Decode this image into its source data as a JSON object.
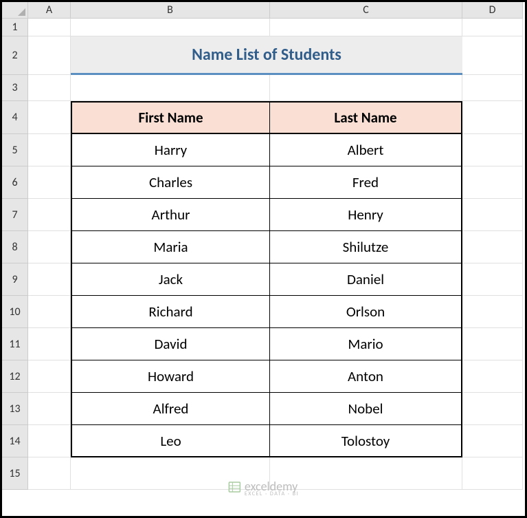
{
  "columns": [
    "A",
    "B",
    "C",
    "D"
  ],
  "rows": [
    "1",
    "2",
    "3",
    "4",
    "5",
    "6",
    "7",
    "8",
    "9",
    "10",
    "11",
    "12",
    "13",
    "14",
    "15"
  ],
  "title": "Name List of Students",
  "headers": {
    "first": "First Name",
    "last": "Last Name"
  },
  "data": [
    {
      "first": "Harry",
      "last": "Albert"
    },
    {
      "first": "Charles",
      "last": "Fred"
    },
    {
      "first": "Arthur",
      "last": "Henry"
    },
    {
      "first": "Maria",
      "last": "Shilutze"
    },
    {
      "first": "Jack",
      "last": "Daniel"
    },
    {
      "first": "Richard",
      "last": "Orlson"
    },
    {
      "first": "David",
      "last": "Mario"
    },
    {
      "first": "Howard",
      "last": "Anton"
    },
    {
      "first": "Alfred",
      "last": "Nobel"
    },
    {
      "first": "Leo",
      "last": "Tolostoy"
    }
  ],
  "watermark": {
    "brand": "exceldemy",
    "tagline": "EXCEL · DATA · BI"
  }
}
